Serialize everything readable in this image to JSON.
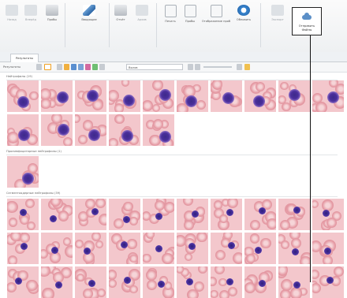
{
  "ribbon": {
    "buttons": [
      {
        "label": "Назад"
      },
      {
        "label": "Вперёд"
      },
      {
        "label": "Пробы"
      },
      {
        "label": "Вводящие"
      },
      {
        "label": "Отчёт"
      },
      {
        "label": "Архив"
      },
      {
        "label": "Печать"
      },
      {
        "label": "Пробы"
      },
      {
        "label": "Отображение проб"
      },
      {
        "label": "Обновить"
      },
      {
        "label": "Экспорт"
      },
      {
        "label": "Отправить"
      }
    ],
    "send_button": {
      "label_line1": "Отправить",
      "label_line2": "Файлы"
    }
  },
  "tabs": {
    "active": "Результаты"
  },
  "toolbar": {
    "left_label": "Результаты",
    "dropdown_value": "Вызов"
  },
  "sections": [
    {
      "title": "Нейтрофилы (19)"
    },
    {
      "title": "Пролимфоцитарные нейтрофилы (1)"
    },
    {
      "title": "Сегментоядерные нейтрофилы (39)"
    }
  ],
  "colors": {
    "accent": "#2a6fb6",
    "wbc": "#4b2f9c",
    "rbc": "#e59aa4"
  }
}
